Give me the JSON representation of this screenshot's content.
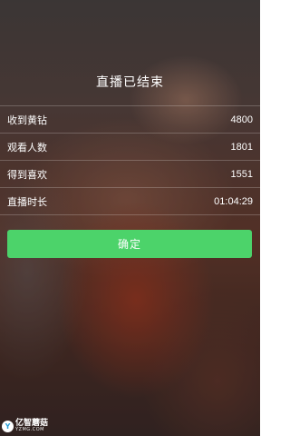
{
  "dialog": {
    "title": "直播已结束",
    "stats": [
      {
        "label": "收到黄钻",
        "value": "4800"
      },
      {
        "label": "观看人数",
        "value": "1801"
      },
      {
        "label": "得到喜欢",
        "value": "1551"
      },
      {
        "label": "直播时长",
        "value": "01:04:29"
      }
    ],
    "confirm_label": "确定"
  },
  "watermark": {
    "logo_glyph": "Y",
    "name": "亿智蘑菇",
    "url": "YZMG.COM"
  },
  "colors": {
    "confirm_button": "#4cd36a",
    "text": "#ffffff"
  }
}
